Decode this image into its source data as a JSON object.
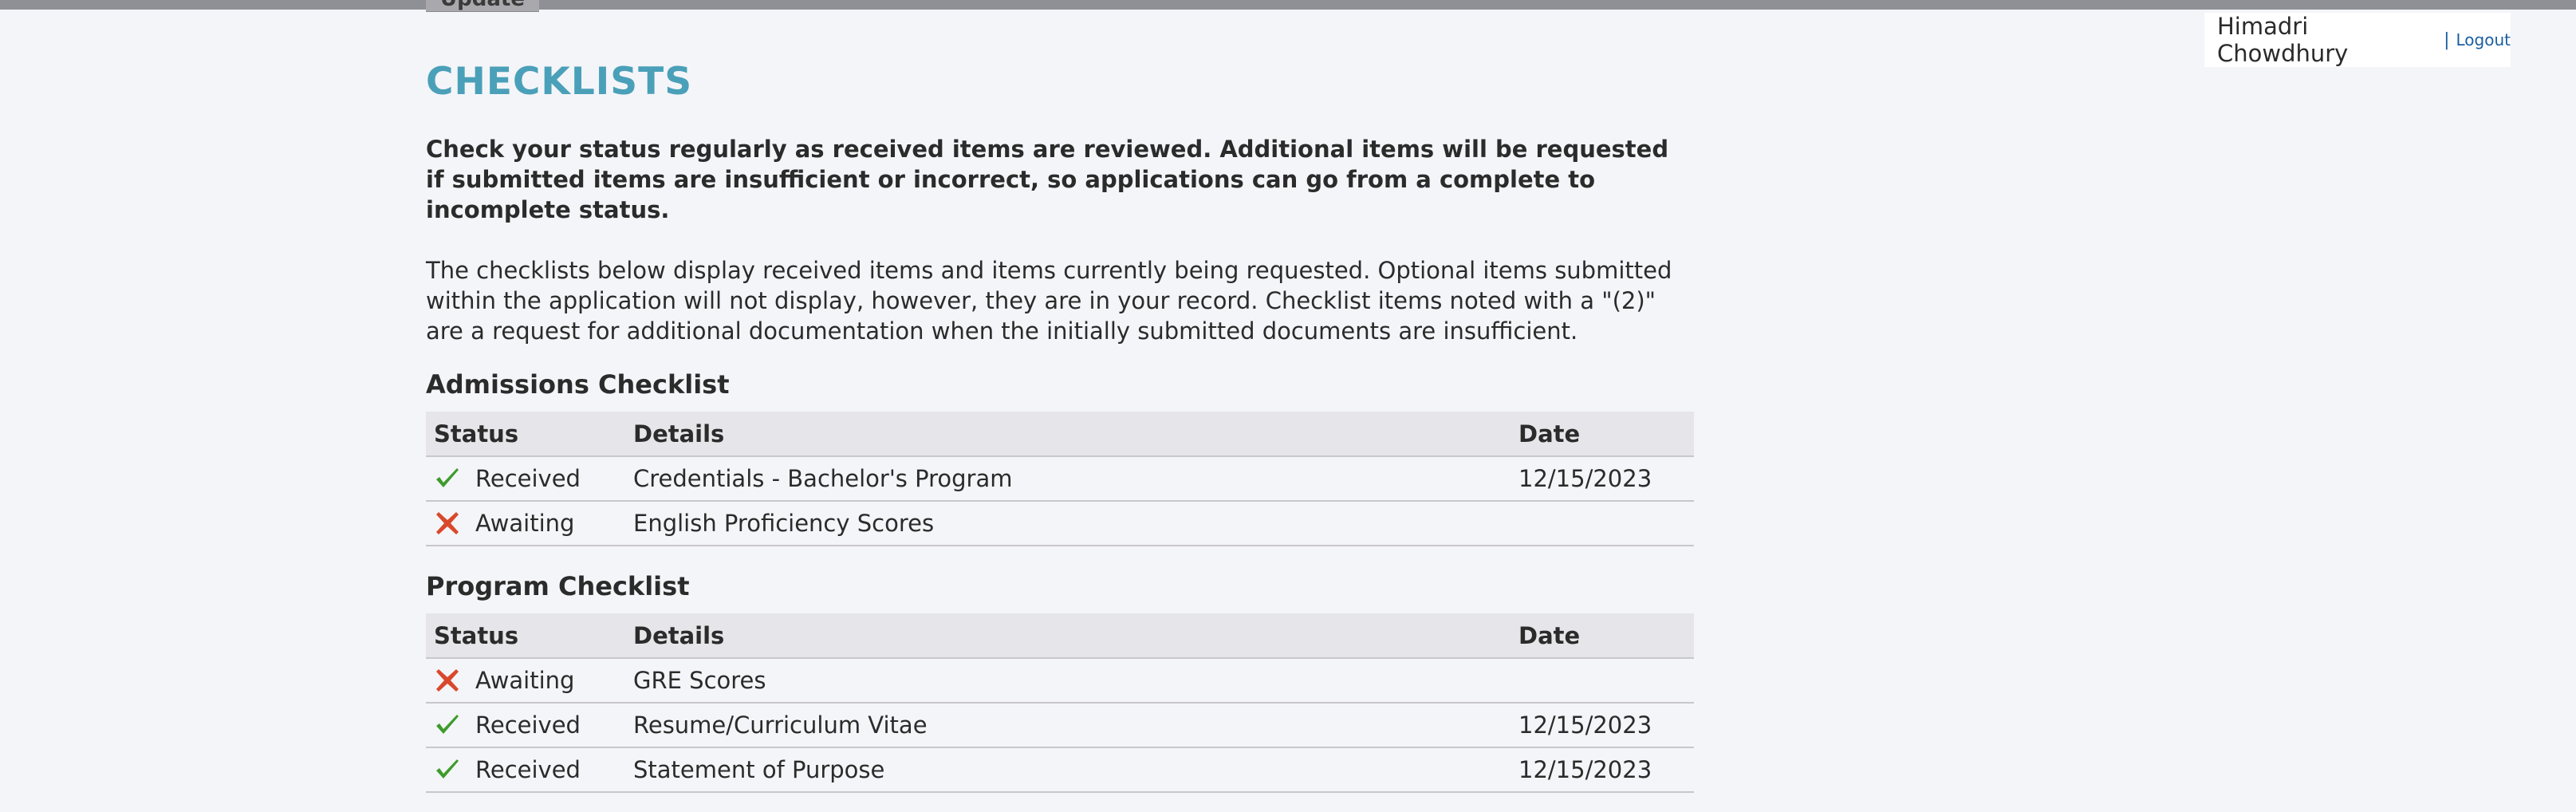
{
  "header": {
    "tab_label": "Update",
    "user_name": "Himadri Chowdhury",
    "separator": "|",
    "logout_label": "Logout"
  },
  "page": {
    "title": "CHECKLISTS",
    "intro_bold": "Check your status regularly as received items are reviewed. Additional items will be requested if submitted items are insufficient or incorrect, so applications can go from a complete to incomplete status.",
    "intro_text": "The checklists below display received items and items currently being requested. Optional items submitted within the application will not display, however, they are in your record. Checklist items noted with a \"(2)\" are a request for additional documentation when the initially submitted documents are insufficient."
  },
  "columns": {
    "status": "Status",
    "details": "Details",
    "date": "Date"
  },
  "admissions": {
    "title": "Admissions Checklist",
    "rows": [
      {
        "status": "Received",
        "icon": "check-icon",
        "details": "Credentials - Bachelor's Program",
        "date": "12/15/2023"
      },
      {
        "status": "Awaiting",
        "icon": "x-icon",
        "details": "English Proficiency Scores",
        "date": ""
      }
    ]
  },
  "program": {
    "title": "Program Checklist",
    "rows": [
      {
        "status": "Awaiting",
        "icon": "x-icon",
        "details": "GRE Scores",
        "date": ""
      },
      {
        "status": "Received",
        "icon": "check-icon",
        "details": "Resume/Curriculum Vitae",
        "date": "12/15/2023"
      },
      {
        "status": "Received",
        "icon": "check-icon",
        "details": "Statement of Purpose",
        "date": "12/15/2023"
      }
    ]
  },
  "colors": {
    "title": "#4aa0b8",
    "received": "#3e9b2a",
    "awaiting": "#d9482b",
    "link": "#1a5fa0"
  }
}
